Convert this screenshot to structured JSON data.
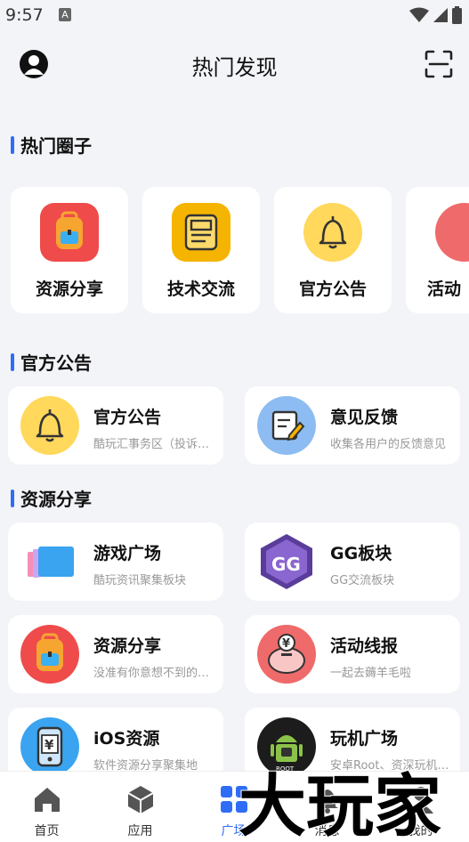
{
  "status_bar": {
    "time": "9:57",
    "notif_icon": "a-notification-icon"
  },
  "header": {
    "title": "热门发现"
  },
  "hot_circles": {
    "title": "热门圈子",
    "items": [
      {
        "label": "资源分享",
        "icon": "backpack-icon",
        "color": "#ef4b4b"
      },
      {
        "label": "技术交流",
        "icon": "document-icon",
        "color": "#f5b400"
      },
      {
        "label": "官方公告",
        "icon": "bell-icon",
        "color": "#ffd85c"
      },
      {
        "label": "活动",
        "icon": "piggy-bank-icon",
        "color": "#ef6a6a"
      }
    ]
  },
  "announcements": {
    "title": "官方公告",
    "items": [
      {
        "title": "官方公告",
        "subtitle": "酷玩汇事务区（投诉举报）",
        "icon": "bell-icon"
      },
      {
        "title": "意见反馈",
        "subtitle": "收集各用户的反馈意见",
        "icon": "feedback-icon"
      }
    ]
  },
  "resources": {
    "title": "资源分享",
    "items": [
      {
        "title": "游戏广场",
        "subtitle": "酷玩资讯聚集板块",
        "icon": "game-cards-icon"
      },
      {
        "title": "GG板块",
        "subtitle": "GG交流板块",
        "icon": "gg-logo-icon"
      },
      {
        "title": "资源分享",
        "subtitle": "没准有你意想不到的资源",
        "icon": "backpack-icon"
      },
      {
        "title": "活动线报",
        "subtitle": "一起去薅羊毛啦",
        "icon": "piggy-bank-icon"
      },
      {
        "title": "iOS资源",
        "subtitle": "软件资源分享聚集地",
        "icon": "phone-yuan-icon"
      },
      {
        "title": "玩机广场",
        "subtitle": "安卓Root、资深玩机交流",
        "icon": "android-root-icon"
      }
    ]
  },
  "tab_bar": {
    "items": [
      {
        "label": "首页",
        "icon": "home-icon"
      },
      {
        "label": "应用",
        "icon": "cube-icon"
      },
      {
        "label": "广场",
        "icon": "grid-icon",
        "active": true
      },
      {
        "label": "消息",
        "icon": "bell-icon"
      },
      {
        "label": "我的",
        "icon": "user-icon"
      }
    ]
  },
  "watermark": {
    "text": "大玩家"
  },
  "colors": {
    "accent": "#2f6df6",
    "background": "#f3f4f8"
  }
}
